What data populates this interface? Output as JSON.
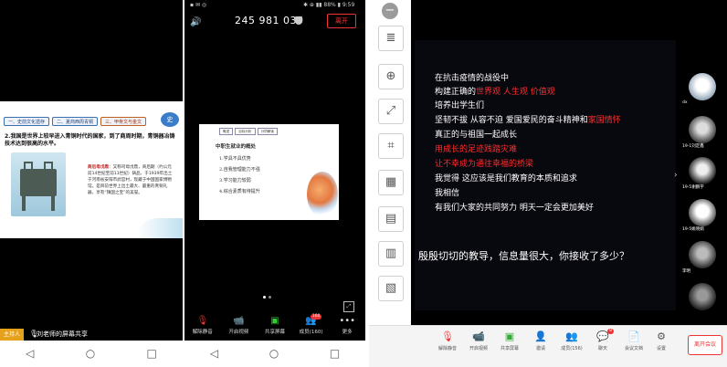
{
  "panel1": {
    "slide": {
      "tabs": [
        "一、史前文化遗存",
        "二、夏商西周青铜",
        "三、甲骨文与金文"
      ],
      "logo_text": "史",
      "heading": "2.我国是世界上较早进入青铜时代的国家，到了商周时期，青铜器冶铸技术达到很高的水平。",
      "body_highlight": "商后母戊鼎",
      "body_text": "：又称司母戊鼎，商后期（约公元前14世纪至前11世纪）铸品，于1939年出土于河南省安阳市武官村，现藏于中国国家博物馆。是目前世界上出土最大、最重的青铜礼器，享有“镇国之宝”的美誉。"
    },
    "host_badge": "主持人",
    "share_text": "刘老师的屏幕共享",
    "nav": [
      "◁",
      "○",
      "□"
    ]
  },
  "panel2": {
    "status_left": "▪ ✉ ◎",
    "status_right": "✱ ⊕ ▮▮ 88% ▮ 9:59",
    "meeting_id": "245 981 030",
    "leave_label": "离开",
    "slide": {
      "tabs": [
        "概述",
        "目标分析",
        "分项解读"
      ],
      "title": "中职生就业的概处",
      "items": [
        "1.学具不具优势",
        "2.自我管理能力不强",
        "3.学习能力较弱",
        "4.综合素质有待提升"
      ]
    },
    "toolbar": [
      {
        "label": "解除静音",
        "icon": "🎙"
      },
      {
        "label": "开启视频",
        "icon": "📹"
      },
      {
        "label": "共享屏幕",
        "icon": "▣"
      },
      {
        "label": "成员(160)",
        "icon": "👥",
        "badge": "160"
      },
      {
        "label": "更多",
        "icon": "•••"
      }
    ],
    "nav": [
      "◁",
      "○",
      "□"
    ]
  },
  "panel3": {
    "sidebar_tools": [
      "≣",
      "⊕",
      "⤢",
      "⌗",
      "▦",
      "▤",
      "▥",
      "▧"
    ],
    "slide_lines": [
      {
        "parts": [
          {
            "t": "在抗击疫情的战役中",
            "r": false
          }
        ]
      },
      {
        "parts": [
          {
            "t": "构建正确的",
            "r": false
          },
          {
            "t": "世界观 人生观 价值观",
            "r": true
          }
        ]
      },
      {
        "parts": [
          {
            "t": "培养出学生们",
            "r": false
          }
        ]
      },
      {
        "parts": [
          {
            "t": "坚韧不拔 从容不迫 爱国爱民的奋斗精神和",
            "r": false
          },
          {
            "t": "家国情怀",
            "r": true
          }
        ]
      },
      {
        "parts": [
          {
            "t": "真正的与祖国一起成长",
            "r": false
          }
        ]
      },
      {
        "parts": [
          {
            "t": "用成长的足迹践踏灾难",
            "r": true
          }
        ]
      },
      {
        "parts": [
          {
            "t": "让不幸成为通往幸福的桥梁",
            "r": true
          }
        ]
      },
      {
        "parts": [
          {
            "t": "我觉得 这应该是我们教育的本质和追求",
            "r": false
          }
        ]
      },
      {
        "parts": [
          {
            "t": "我相信",
            "r": false
          }
        ]
      },
      {
        "parts": [
          {
            "t": "有我们大家的共同努力 明天一定会更加美好",
            "r": false
          }
        ]
      }
    ],
    "slide_question": "殷殷切切的教导，信息量很大，你接收了多少？",
    "participants": [
      {
        "name": "dx"
      },
      {
        "name": "19-1刘定鑫"
      },
      {
        "name": "19-5谢鹏宇"
      },
      {
        "name": "19-5姚晓娟"
      },
      {
        "name": "李明"
      },
      {
        "name": ""
      }
    ],
    "bottom_buttons": [
      {
        "label": "解除静音",
        "icon": "🎙"
      },
      {
        "label": "开启视频",
        "icon": "📹"
      },
      {
        "label": "共享屏幕",
        "icon": "▣"
      },
      {
        "label": "邀请",
        "icon": "👤"
      },
      {
        "label": "成员(156)",
        "icon": "👥"
      },
      {
        "label": "聊天",
        "icon": "💬",
        "badge": "8"
      },
      {
        "label": "会议文档",
        "icon": "📄"
      },
      {
        "label": "设置",
        "icon": "⚙"
      }
    ],
    "leave_label": "离开会议"
  }
}
